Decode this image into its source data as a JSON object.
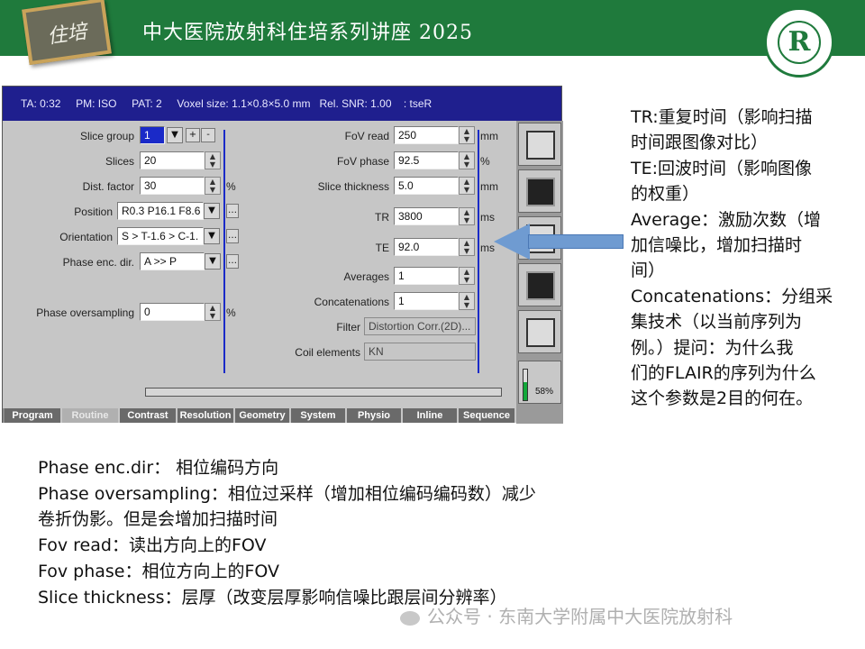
{
  "header": {
    "title": "中大医院放射科住培系列讲座 2025",
    "badge_text": "住培",
    "logo_text": "R"
  },
  "scanner": {
    "status_line": "TA: 0:32     PM: ISO     PAT: 2     Voxel size: 1.1×0.8×5.0 mm   Rel. SNR: 1.00    : tseR",
    "left": {
      "slice_group_label": "Slice group",
      "slice_group_value": "1",
      "slices_label": "Slices",
      "slices_value": "20",
      "dist_factor_label": "Dist. factor",
      "dist_factor_value": "30",
      "dist_factor_unit": "%",
      "position_label": "Position",
      "position_value": "R0.3 P16.1 F8.6",
      "orientation_label": "Orientation",
      "orientation_value": "S > T-1.6 > C-1.",
      "phase_enc_label": "Phase enc. dir.",
      "phase_enc_value": "A >> P",
      "oversampling_label": "Phase oversampling",
      "oversampling_value": "0",
      "oversampling_unit": "%"
    },
    "right": {
      "fov_read_label": "FoV read",
      "fov_read_value": "250",
      "fov_read_unit": "mm",
      "fov_phase_label": "FoV phase",
      "fov_phase_value": "92.5",
      "fov_phase_unit": "%",
      "thickness_label": "Slice thickness",
      "thickness_value": "5.0",
      "thickness_unit": "mm",
      "tr_label": "TR",
      "tr_value": "3800",
      "tr_unit": "ms",
      "te_label": "TE",
      "te_value": "92.0",
      "te_unit": "ms",
      "averages_label": "Averages",
      "averages_value": "1",
      "concat_label": "Concatenations",
      "concat_value": "1",
      "filter_label": "Filter",
      "filter_value": "Distortion Corr.(2D)...",
      "coil_label": "Coil elements",
      "coil_value": "KN"
    },
    "tabs": [
      "Program",
      "Routine",
      "Contrast",
      "Resolution",
      "Geometry",
      "System",
      "Physio",
      "Inline",
      "Sequence"
    ],
    "active_tab": "Routine",
    "gauge_percent": "58%",
    "gauge_level": 0.58
  },
  "notes_right": [
    "TR:重复时间（影响扫描",
    "时间跟图像对比）",
    "TE:回波时间（影响图像",
    "的权重）",
    "Average：激励次数（增",
    "加信噪比，增加扫描时",
    "间）",
    "Concatenations：分组采",
    "集技术（以当前序列为",
    "例。）提问：为什么我",
    "们的FLAIR的序列为什么",
    "这个参数是2目的何在。"
  ],
  "notes_bottom": [
    "Phase enc.dir： 相位编码方向",
    "Phase oversampling：相位过采样（增加相位编码编码数）减少",
    "卷折伪影。但是会增加扫描时间",
    "Fov read：读出方向上的FOV",
    "Fov phase：相位方向上的FOV",
    "Slice thickness：层厚（改变层厚影响信噪比跟层间分辨率）"
  ],
  "watermark": "公众号 · 东南大学附属中大医院放射科"
}
